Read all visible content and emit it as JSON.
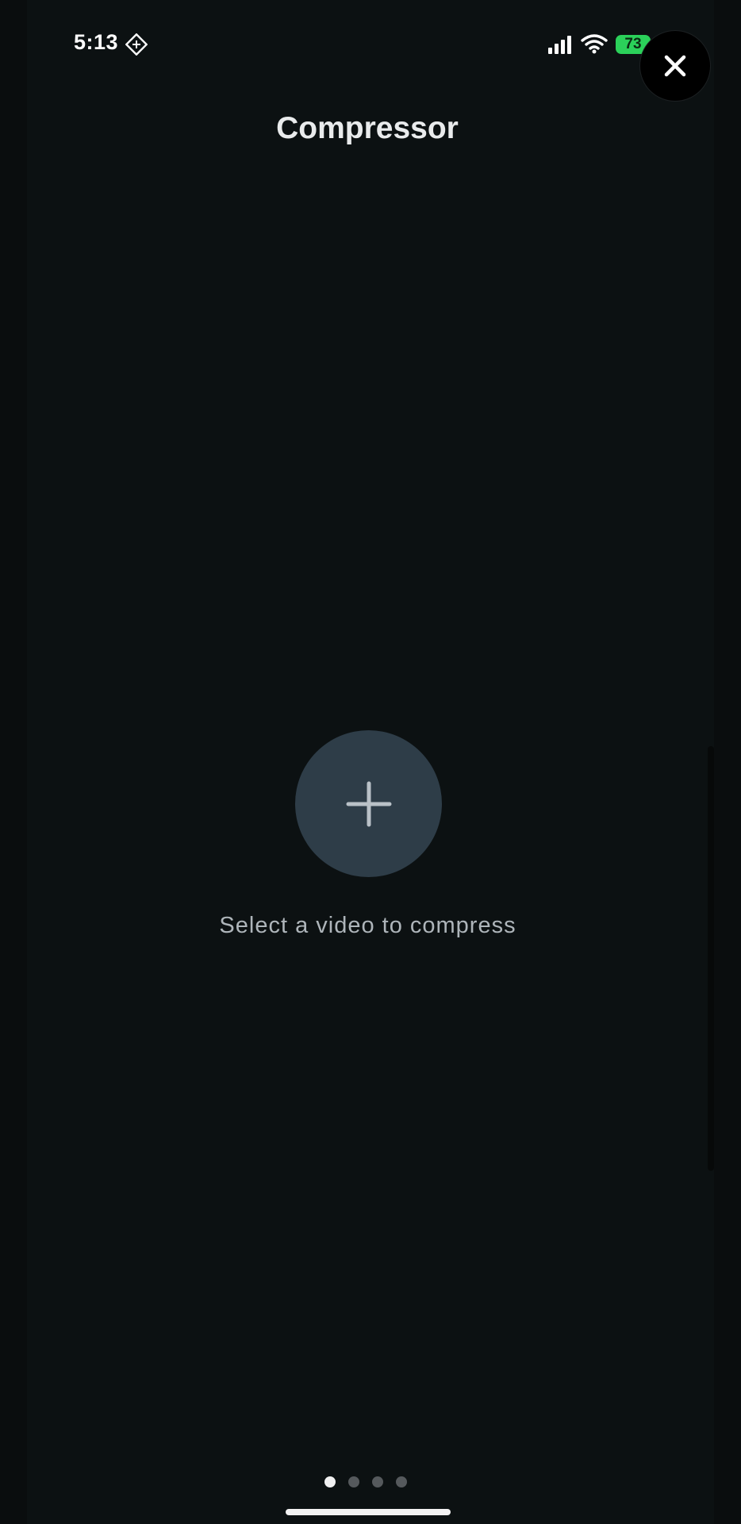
{
  "status_bar": {
    "time": "5:13",
    "battery_level": "73",
    "icons": [
      "app-indicator-icon",
      "cellular-signal-icon",
      "wifi-icon",
      "charging-bolt-icon"
    ]
  },
  "header": {
    "title": "Compressor",
    "close_icon": "close-icon"
  },
  "main": {
    "add_icon": "plus-icon",
    "prompt": "Select a video to compress"
  },
  "pagination": {
    "total_pages": 4,
    "current_page": 1
  },
  "colors": {
    "background": "#0c1112",
    "add_button": "#2e3d48",
    "battery": "#2bd15a",
    "prompt_text": "#aeb5ba"
  }
}
